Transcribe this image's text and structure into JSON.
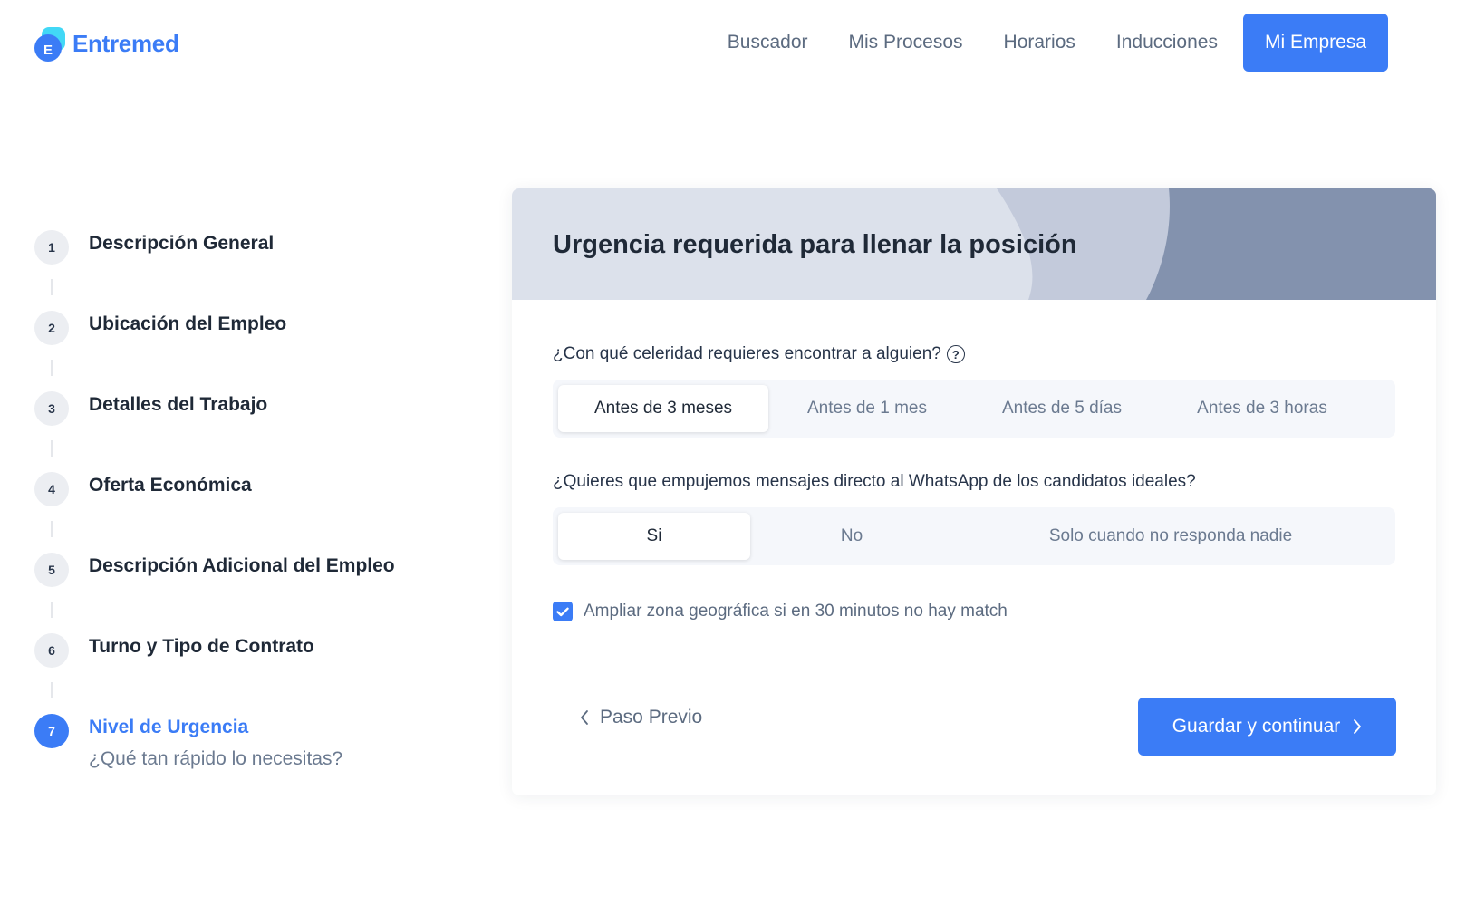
{
  "brand": {
    "name": "Entremed",
    "logo_letter": "E"
  },
  "nav": {
    "links": [
      "Buscador",
      "Mis Procesos",
      "Horarios",
      "Inducciones"
    ],
    "cta": "Mi Empresa"
  },
  "steps": [
    {
      "number": "1",
      "label": "Descripción General"
    },
    {
      "number": "2",
      "label": "Ubicación del Empleo"
    },
    {
      "number": "3",
      "label": "Detalles del Trabajo"
    },
    {
      "number": "4",
      "label": "Oferta Económica"
    },
    {
      "number": "5",
      "label": "Descripción Adicional del Empleo"
    },
    {
      "number": "6",
      "label": "Turno y Tipo de Contrato"
    },
    {
      "number": "7",
      "label": "Nivel de Urgencia",
      "sub": "¿Qué tan rápido lo necesitas?",
      "active": true
    }
  ],
  "form": {
    "title": "Urgencia requerida para llenar la posición",
    "q1": {
      "label": "¿Con qué celeridad requieres encontrar a alguien?",
      "help_icon": "question-circle-icon",
      "options": [
        "Antes de 3 meses",
        "Antes de 1 mes",
        "Antes de 5 días",
        "Antes de 3 horas"
      ],
      "selected": "Antes de 3 meses"
    },
    "q2": {
      "label": "¿Quieres que empujemos mensajes directo al WhatsApp de los candidatos ideales?",
      "options": [
        "Si",
        "No",
        "Solo cuando no responda nadie"
      ],
      "selected": "Si"
    },
    "checkbox": {
      "label": "Ampliar zona geográfica si en 30 minutos no hay match",
      "checked": true
    },
    "prev_label": "Paso Previo",
    "next_label": "Guardar y continuar"
  },
  "colors": {
    "accent": "#3b7cf6",
    "header_band": "#dce1eb",
    "header_band_dark": "#8392ae"
  }
}
